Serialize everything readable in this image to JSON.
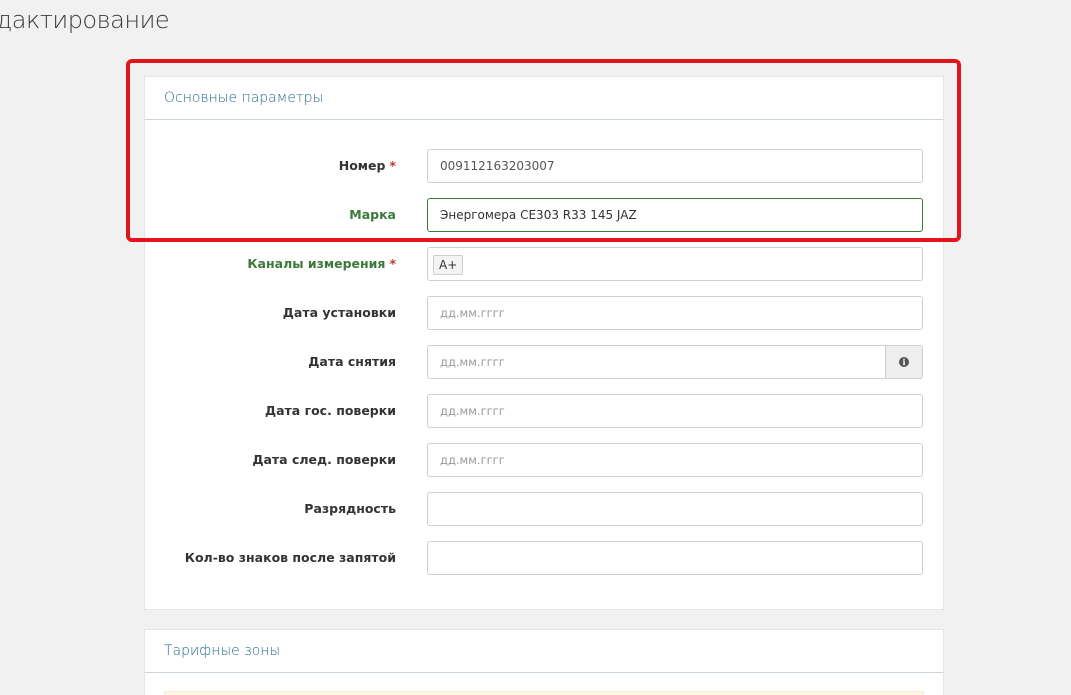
{
  "page": {
    "title": "дактирование"
  },
  "main_panel": {
    "heading": "Основные параметры",
    "fields": [
      {
        "label": "Номер",
        "required": "*",
        "value": "009112163203007"
      },
      {
        "label": "Марка",
        "value": "Энергомера CE303 R33 145 JAZ"
      },
      {
        "label": "Каналы измерения",
        "required": "*",
        "button": "A+"
      },
      {
        "label": "Дата установки",
        "placeholder": "дд.мм.гггг"
      },
      {
        "label": "Дата снятия",
        "placeholder": "дд.мм.гггг",
        "addon_icon": "info-icon"
      },
      {
        "label": "Дата гос. поверки",
        "placeholder": "дд.мм.гггг"
      },
      {
        "label": "Дата след. поверки",
        "placeholder": "дд.мм.гггг"
      },
      {
        "label": "Разрядность",
        "value": ""
      },
      {
        "label": "Кол-во знаков после запятой",
        "value": ""
      }
    ]
  },
  "tariff_panel": {
    "heading": "Тарифные зоны"
  },
  "colors": {
    "highlight": "#e2141c",
    "label_green": "#3b7a3b",
    "heading_blue": "#2b6b8c",
    "required": "#c0392b"
  }
}
